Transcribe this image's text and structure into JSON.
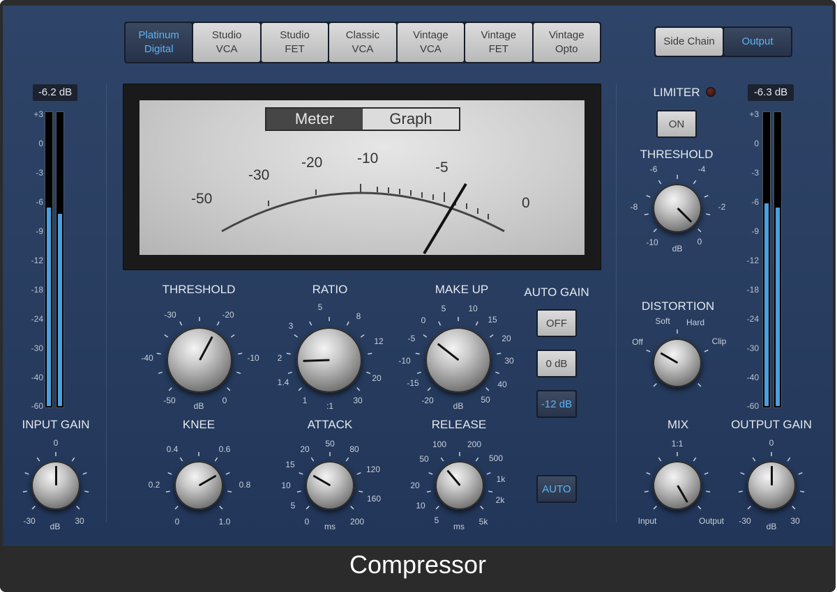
{
  "app": {
    "title": "Compressor"
  },
  "models": [
    {
      "line1": "Platinum",
      "line2": "Digital",
      "selected": true
    },
    {
      "line1": "Studio",
      "line2": "VCA",
      "selected": false
    },
    {
      "line1": "Studio",
      "line2": "FET",
      "selected": false
    },
    {
      "line1": "Classic",
      "line2": "VCA",
      "selected": false
    },
    {
      "line1": "Vintage",
      "line2": "VCA",
      "selected": false
    },
    {
      "line1": "Vintage",
      "line2": "FET",
      "selected": false
    },
    {
      "line1": "Vintage",
      "line2": "Opto",
      "selected": false
    }
  ],
  "routing": {
    "side_chain": "Side Chain",
    "output": "Output",
    "selected": "Output"
  },
  "input_meter": {
    "readout": "-6.2 dB",
    "scale": [
      "+3",
      "0",
      "-3",
      "-6",
      "-9",
      "-12",
      "-18",
      "-24",
      "-30",
      "-40",
      "-60"
    ],
    "level_left_fraction": 0.675,
    "level_right_fraction": 0.655
  },
  "output_meter": {
    "readout": "-6.3 dB",
    "scale": [
      "+3",
      "0",
      "-3",
      "-6",
      "-9",
      "-12",
      "-18",
      "-24",
      "-30",
      "-40",
      "-60"
    ],
    "level_left_fraction": 0.69,
    "level_right_fraction": 0.675
  },
  "display": {
    "tab_meter": "Meter",
    "tab_graph": "Graph",
    "selected_tab": "Meter",
    "scale_labels": [
      "-50",
      "-30",
      "-20",
      "-10",
      "-5",
      "0"
    ],
    "needle_value_db": -3.5
  },
  "controls": {
    "threshold": {
      "label": "THRESHOLD",
      "ticks": [
        "-40",
        "-30",
        "-20",
        "-10",
        "-50",
        "0"
      ],
      "unit": "dB"
    },
    "ratio": {
      "label": "RATIO",
      "ticks": [
        "1.4",
        "2",
        "3",
        "5",
        "8",
        "12",
        "20",
        "30",
        "1"
      ],
      "unit": ":1"
    },
    "makeup": {
      "label": "MAKE UP",
      "ticks": [
        "-20",
        "-15",
        "-10",
        "-5",
        "0",
        "5",
        "10",
        "15",
        "20",
        "30",
        "40",
        "50"
      ],
      "unit": "dB"
    },
    "knee": {
      "label": "KNEE",
      "ticks": [
        "0",
        "0.2",
        "0.4",
        "0.6",
        "0.8",
        "1.0"
      ]
    },
    "attack": {
      "label": "ATTACK",
      "ticks": [
        "0",
        "5",
        "10",
        "15",
        "20",
        "50",
        "80",
        "120",
        "160",
        "200"
      ],
      "unit": "ms"
    },
    "release": {
      "label": "RELEASE",
      "ticks": [
        "5",
        "10",
        "20",
        "50",
        "100",
        "200",
        "500",
        "1k",
        "2k",
        "5k"
      ],
      "unit": "ms"
    },
    "input_gain": {
      "label": "INPUT GAIN",
      "ticks": [
        "-30",
        "0",
        "30"
      ],
      "unit": "dB"
    },
    "output_gain": {
      "label": "OUTPUT GAIN",
      "ticks": [
        "-30",
        "0",
        "30"
      ],
      "unit": "dB"
    },
    "mix": {
      "label": "MIX",
      "top": "1:1",
      "left": "Input",
      "right": "Output"
    },
    "distortion": {
      "label": "DISTORTION",
      "ticks": [
        "Off",
        "Soft",
        "Hard",
        "Clip"
      ]
    },
    "limiter": {
      "label": "LIMITER",
      "on": "ON",
      "threshold_label": "THRESHOLD",
      "ticks": [
        "-10",
        "-8",
        "-6",
        "-4",
        "-2",
        "0"
      ],
      "unit": "dB"
    }
  },
  "auto_gain": {
    "label": "AUTO GAIN",
    "options": [
      "OFF",
      "0 dB",
      "-12 dB"
    ],
    "selected": "-12 dB"
  },
  "auto_release": {
    "label": "AUTO",
    "active": true
  },
  "colors": {
    "accent": "#5ab4f5",
    "panel": "#2b4066",
    "meter": "#4a9fe0"
  }
}
